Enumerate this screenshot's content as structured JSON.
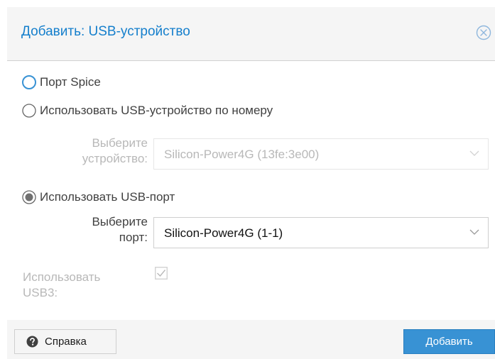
{
  "dialog": {
    "title": "Добавить: USB-устройство",
    "close_icon": "close-circle-icon"
  },
  "options": {
    "spice_label": "Порт Spice",
    "by_device_label": "Использовать USB-устройство по номеру",
    "by_port_label": "Использовать USB-порт",
    "selected": "by_port"
  },
  "device_field": {
    "label_line1": "Выберите",
    "label_line2": "устройство:",
    "value": "Silicon-Power4G (13fe:3e00)",
    "enabled": false
  },
  "port_field": {
    "label_line1": "Выберите",
    "label_line2": "порт:",
    "value": "Silicon-Power4G (1-1)",
    "enabled": true
  },
  "usb3": {
    "label_line1": "Использовать",
    "label_line2": "USB3:",
    "checked": true,
    "enabled": false
  },
  "footer": {
    "help_label": "Справка",
    "help_icon": "question-circle-icon",
    "add_label": "Добавить"
  },
  "colors": {
    "accent": "#157fcc",
    "primary_button": "#3892d4",
    "disabled_text": "#b8b8b8"
  }
}
